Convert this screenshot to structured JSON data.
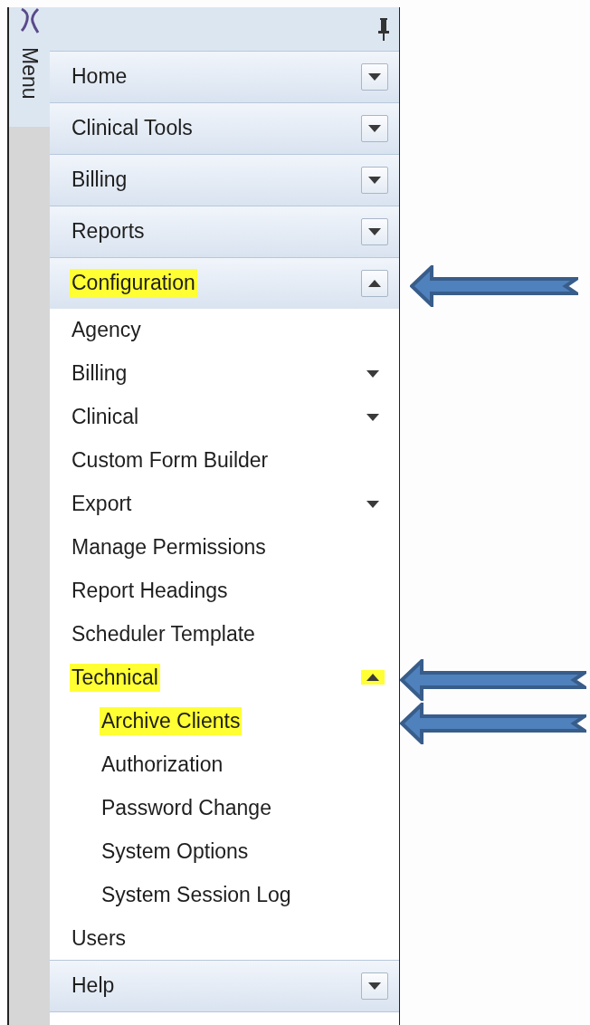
{
  "sidebar": {
    "tab_label": "Menu",
    "sections": [
      {
        "label": "Home",
        "expanded": false,
        "highlighted": false,
        "arrow": false
      },
      {
        "label": "Clinical Tools",
        "expanded": false,
        "highlighted": false,
        "arrow": false
      },
      {
        "label": "Billing",
        "expanded": false,
        "highlighted": false,
        "arrow": false
      },
      {
        "label": "Reports",
        "expanded": false,
        "highlighted": false,
        "arrow": false
      },
      {
        "label": "Configuration",
        "expanded": true,
        "highlighted": true,
        "arrow": true,
        "items": [
          {
            "label": "Agency",
            "kind": "link",
            "highlighted": false,
            "arrow": false
          },
          {
            "label": "Billing",
            "kind": "group",
            "expanded": false,
            "highlighted": false,
            "arrow": false
          },
          {
            "label": "Clinical",
            "kind": "group",
            "expanded": false,
            "highlighted": false,
            "arrow": false
          },
          {
            "label": "Custom Form Builder",
            "kind": "link",
            "highlighted": false,
            "arrow": false
          },
          {
            "label": "Export",
            "kind": "group",
            "expanded": false,
            "highlighted": false,
            "arrow": false
          },
          {
            "label": "Manage Permissions",
            "kind": "link",
            "highlighted": false,
            "arrow": false
          },
          {
            "label": "Report Headings",
            "kind": "link",
            "highlighted": false,
            "arrow": false
          },
          {
            "label": "Scheduler Template",
            "kind": "link",
            "highlighted": false,
            "arrow": false
          },
          {
            "label": "Technical",
            "kind": "group",
            "expanded": true,
            "highlighted": true,
            "arrow": true,
            "children": [
              {
                "label": "Archive Clients",
                "kind": "link",
                "highlighted": true,
                "arrow": true
              },
              {
                "label": "Authorization",
                "kind": "link",
                "highlighted": false,
                "arrow": false
              },
              {
                "label": "Password Change",
                "kind": "link",
                "highlighted": false,
                "arrow": false
              },
              {
                "label": "System Options",
                "kind": "link",
                "highlighted": false,
                "arrow": false
              },
              {
                "label": "System Session Log",
                "kind": "link",
                "highlighted": false,
                "arrow": false
              }
            ]
          },
          {
            "label": "Users",
            "kind": "link",
            "highlighted": false,
            "arrow": false
          }
        ]
      },
      {
        "label": "Help",
        "expanded": false,
        "highlighted": false,
        "arrow": false
      }
    ]
  }
}
